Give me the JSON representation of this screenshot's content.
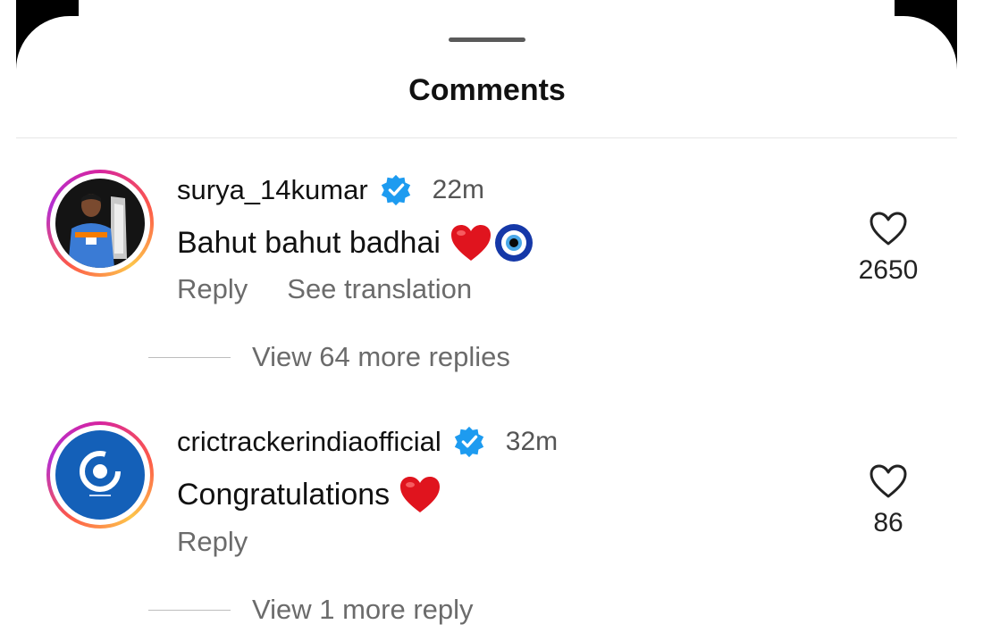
{
  "sheet": {
    "title": "Comments"
  },
  "comments": [
    {
      "username": "surya_14kumar",
      "time": "22m",
      "text": "Bahut bahut badhai",
      "actions": [
        "Reply",
        "See translation"
      ],
      "likes": "2650",
      "view_replies": "View 64 more replies"
    },
    {
      "username": "crictrackerindiaofficial",
      "time": "32m",
      "text": "Congratulations",
      "actions": [
        "Reply"
      ],
      "likes": "86",
      "view_replies": "View 1 more reply"
    }
  ],
  "colors": {
    "verified": "#1d9bf0",
    "heart": "#e0141e",
    "avatar2_bg": "#1460b8"
  },
  "icons": [
    "verified-badge-icon",
    "heart-outline-icon",
    "red-heart-icon",
    "nazar-amulet-icon"
  ]
}
